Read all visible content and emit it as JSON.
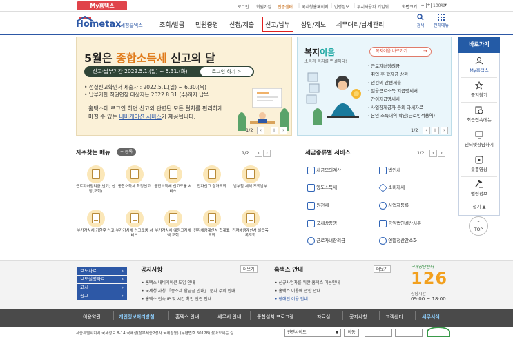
{
  "topbar": {
    "myhometax": "My홈택스",
    "links": [
      "로그인",
      "회원가입",
      "인증센터",
      "국세청홈페이지",
      "법령정보",
      "부서사용자 기업뒤"
    ],
    "zoom_label": "화면크기",
    "zoom_value": "100%"
  },
  "header": {
    "logo_text": "Hometax",
    "logo_sub": "국세청홈택스",
    "menus": [
      "조회/발급",
      "민원증명",
      "신청/제출",
      "신고/납부",
      "상담/제보",
      "세무대리/납세관리"
    ],
    "search_label": "검색",
    "allmenu_label": "전체메뉴"
  },
  "banner1": {
    "title_part1": "5월은 ",
    "title_highlight": "종합소득세",
    "title_part2": " 신고의 달",
    "period": "신고·납부기간  2022.5.1.(일) ~ 5.31.(화)",
    "login_btn": "로그인 하기  >",
    "bullet1": "• 성실신고확인서 제출자 : 2022.5.1.(일) ~ 6.30.(목)",
    "bullet2": "• 납부기한 직권연장 대상자는 2022.8.31.(수)까지 납부",
    "desc1": "홈택스에 로그인 하면 신고와 관련된 모든 절차를 편리하게",
    "desc2_part1": "마칠 수 있는 ",
    "desc2_link": "내비게이션 서비스",
    "desc2_part2": "가 제공됩니다.",
    "pager": "1/2"
  },
  "banner2": {
    "title_part1": "복지",
    "title_part2": "이음",
    "subtitle": "소득과 복지를 연결하다!",
    "button": "복지이음 바로가기",
    "items": [
      "근로자녀장려금",
      "취업 후 학자금 상환",
      "인건비 간편제출",
      "일용근로소득 지급명세서",
      "간이지급명세서",
      "사업장제공자 등의 과세자료",
      "본인 소득내역 확인(근로인적용역)"
    ],
    "pager": "1/2"
  },
  "quick": {
    "title": "바로가기",
    "items": [
      "My홈택스",
      "즐겨찾기",
      "최근접속메뉴",
      "인터넷상담하기",
      "숏폼영상",
      "법령정보"
    ],
    "collapse": "접기 ▲",
    "top_btn": "TOP"
  },
  "favorites": {
    "title": "자주찾는 메뉴",
    "add_label": "+ 등록",
    "pager": "1/2",
    "items": [
      "근로자녀장려금(반기) 신청(조회)",
      "종합소득세 확정신고",
      "종합소득세 신고도움 서비스",
      "전자신고 결과조회",
      "납부할 세액 조회납부",
      "부가가치세 기한후 신고",
      "부가가치세 신고도움 서비스",
      "부가가치세 예정고지세액 조회",
      "전자세금계산서 합계표조회",
      "전자세금계산서 발급목록조회"
    ]
  },
  "tax_services": {
    "title": "세금종류별 서비스",
    "pager": "1/2",
    "left": [
      "세금모의계산",
      "양도소득세",
      "원천세",
      "국세상증명",
      "근로자녀장려금"
    ],
    "right": [
      "법인세",
      "소비제세",
      "사업자등록",
      "공익법인결산서류",
      "연말정산간소화"
    ]
  },
  "footer": {
    "news_buttons": [
      "보도자료",
      "보도설명자료",
      "고시",
      "공고"
    ],
    "notice_title": "공지사항",
    "notice_more": "더보기",
    "notices": [
      "홈택스 내비게이션 도입 안내",
      "국세청 사칭 「종소세 환급금 안내」 문자 주의 안내",
      "홈택스 접속 IP 및 시간 확인 관련 안내"
    ],
    "hometax_title": "홈택스 안내",
    "hometax_more": "더보기",
    "hometax_items": [
      "신규사업자를 위한 홈택스 이용안내",
      "홈택스 이용에 관한 안내",
      "장애인 이용 안내"
    ],
    "center_label": "국세상담센터",
    "center_number": "126",
    "hours_label": "상담시간",
    "hours_value": "09:00 ~ 18:00"
  },
  "bottom_nav": [
    "이용약관",
    "개인정보처리방침",
    "홈택스 안내",
    "세무서 안내",
    "통합설치 프로그램",
    "자료실",
    "공지사항",
    "고객센터",
    "세무서식"
  ],
  "bottom_strip": {
    "address": "세종특별자치시 국세청로 8-14 국세청(정부세종2청사 국세청동) (우편번호 30128)   찾아오시는 길",
    "select": "관련사이트",
    "go_btn": "이동"
  },
  "colors": {
    "primary": "#2d58a6",
    "accent_red": "#e0434a",
    "banner1_bg": "#fbf1d8",
    "banner2_bg": "#eaf6fb"
  }
}
